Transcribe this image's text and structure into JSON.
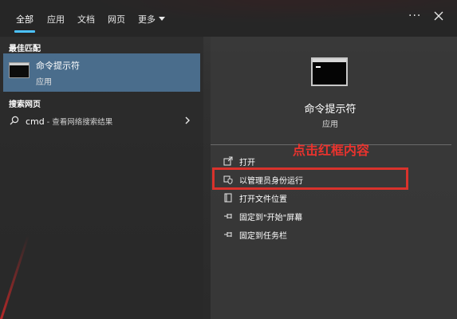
{
  "tabs": [
    {
      "label": "全部",
      "active": true
    },
    {
      "label": "应用"
    },
    {
      "label": "文档"
    },
    {
      "label": "网页"
    },
    {
      "label": "更多"
    }
  ],
  "more_options_label": "···",
  "left": {
    "best_match_label": "最佳匹配",
    "best_match": {
      "title": "命令提示符",
      "subtitle": "应用",
      "icon": "cmd-icon"
    },
    "web_label": "搜索网页",
    "web_result": {
      "query": "cmd",
      "suffix": " - 查看网络搜索结果",
      "icon": "search-icon"
    }
  },
  "right": {
    "app_title": "命令提示符",
    "app_type": "应用",
    "annotation": "点击红框内容",
    "actions": [
      {
        "label": "打开",
        "icon": "open-icon"
      },
      {
        "label": "以管理员身份运行",
        "icon": "shield-icon"
      },
      {
        "label": "打开文件位置",
        "icon": "file-location-icon"
      },
      {
        "label": "固定到\"开始\"屏幕",
        "icon": "pin-icon"
      },
      {
        "label": "固定到任务栏",
        "icon": "pin-icon"
      }
    ]
  },
  "colors": {
    "accent": "#4cc2ff",
    "selection": "#4a6d8c",
    "annotation_red": "#e8332e"
  }
}
